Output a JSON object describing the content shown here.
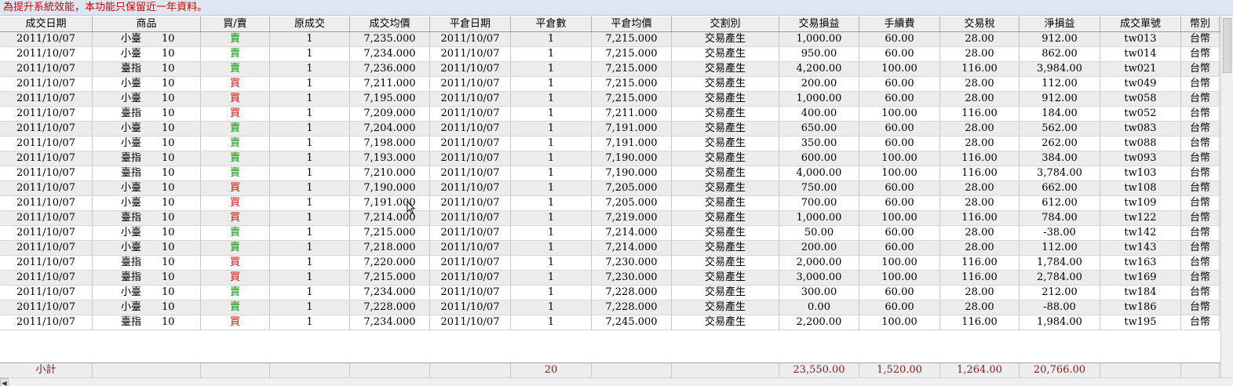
{
  "notice": "為提升系統效能，本功能只保留近一年資料。",
  "columns": [
    "成交日期",
    "商品",
    "買/賣",
    "原成交",
    "成交均價",
    "平倉日期",
    "平倉數",
    "平倉均價",
    "交割別",
    "交易損益",
    "手續費",
    "交易稅",
    "淨損益",
    "成交單號",
    "幣別"
  ],
  "colors": {
    "buy": "#e00000",
    "sell": "#00a000",
    "notice": "#d40000",
    "total": "#8b1a1a"
  },
  "rows": [
    {
      "date": "2011/10/07",
      "product": "小臺",
      "qty": "10",
      "side": "賣",
      "side_type": "sell",
      "orig": "1",
      "avg": "7,235.000",
      "close_date": "2011/10/07",
      "close_qty": "1",
      "close_avg": "7,215.000",
      "settle": "交易產生",
      "pnl": "1,000.00",
      "fee": "60.00",
      "tax": "28.00",
      "net": "912.00",
      "order": "tw013",
      "currency": "台幣"
    },
    {
      "date": "2011/10/07",
      "product": "小臺",
      "qty": "10",
      "side": "賣",
      "side_type": "sell",
      "orig": "1",
      "avg": "7,234.000",
      "close_date": "2011/10/07",
      "close_qty": "1",
      "close_avg": "7,215.000",
      "settle": "交易產生",
      "pnl": "950.00",
      "fee": "60.00",
      "tax": "28.00",
      "net": "862.00",
      "order": "tw014",
      "currency": "台幣"
    },
    {
      "date": "2011/10/07",
      "product": "臺指",
      "qty": "10",
      "side": "賣",
      "side_type": "sell",
      "orig": "1",
      "avg": "7,236.000",
      "close_date": "2011/10/07",
      "close_qty": "1",
      "close_avg": "7,215.000",
      "settle": "交易產生",
      "pnl": "4,200.00",
      "fee": "100.00",
      "tax": "116.00",
      "net": "3,984.00",
      "order": "tw021",
      "currency": "台幣"
    },
    {
      "date": "2011/10/07",
      "product": "小臺",
      "qty": "10",
      "side": "買",
      "side_type": "buy",
      "orig": "1",
      "avg": "7,211.000",
      "close_date": "2011/10/07",
      "close_qty": "1",
      "close_avg": "7,215.000",
      "settle": "交易產生",
      "pnl": "200.00",
      "fee": "60.00",
      "tax": "28.00",
      "net": "112.00",
      "order": "tw049",
      "currency": "台幣"
    },
    {
      "date": "2011/10/07",
      "product": "小臺",
      "qty": "10",
      "side": "買",
      "side_type": "buy",
      "orig": "1",
      "avg": "7,195.000",
      "close_date": "2011/10/07",
      "close_qty": "1",
      "close_avg": "7,215.000",
      "settle": "交易產生",
      "pnl": "1,000.00",
      "fee": "60.00",
      "tax": "28.00",
      "net": "912.00",
      "order": "tw058",
      "currency": "台幣"
    },
    {
      "date": "2011/10/07",
      "product": "臺指",
      "qty": "10",
      "side": "買",
      "side_type": "buy",
      "orig": "1",
      "avg": "7,209.000",
      "close_date": "2011/10/07",
      "close_qty": "1",
      "close_avg": "7,211.000",
      "settle": "交易產生",
      "pnl": "400.00",
      "fee": "100.00",
      "tax": "116.00",
      "net": "184.00",
      "order": "tw052",
      "currency": "台幣"
    },
    {
      "date": "2011/10/07",
      "product": "小臺",
      "qty": "10",
      "side": "賣",
      "side_type": "sell",
      "orig": "1",
      "avg": "7,204.000",
      "close_date": "2011/10/07",
      "close_qty": "1",
      "close_avg": "7,191.000",
      "settle": "交易產生",
      "pnl": "650.00",
      "fee": "60.00",
      "tax": "28.00",
      "net": "562.00",
      "order": "tw083",
      "currency": "台幣"
    },
    {
      "date": "2011/10/07",
      "product": "小臺",
      "qty": "10",
      "side": "賣",
      "side_type": "sell",
      "orig": "1",
      "avg": "7,198.000",
      "close_date": "2011/10/07",
      "close_qty": "1",
      "close_avg": "7,191.000",
      "settle": "交易產生",
      "pnl": "350.00",
      "fee": "60.00",
      "tax": "28.00",
      "net": "262.00",
      "order": "tw088",
      "currency": "台幣"
    },
    {
      "date": "2011/10/07",
      "product": "臺指",
      "qty": "10",
      "side": "賣",
      "side_type": "sell",
      "orig": "1",
      "avg": "7,193.000",
      "close_date": "2011/10/07",
      "close_qty": "1",
      "close_avg": "7,190.000",
      "settle": "交易產生",
      "pnl": "600.00",
      "fee": "100.00",
      "tax": "116.00",
      "net": "384.00",
      "order": "tw093",
      "currency": "台幣"
    },
    {
      "date": "2011/10/07",
      "product": "臺指",
      "qty": "10",
      "side": "賣",
      "side_type": "sell",
      "orig": "1",
      "avg": "7,210.000",
      "close_date": "2011/10/07",
      "close_qty": "1",
      "close_avg": "7,190.000",
      "settle": "交易產生",
      "pnl": "4,000.00",
      "fee": "100.00",
      "tax": "116.00",
      "net": "3,784.00",
      "order": "tw103",
      "currency": "台幣"
    },
    {
      "date": "2011/10/07",
      "product": "小臺",
      "qty": "10",
      "side": "買",
      "side_type": "buy",
      "orig": "1",
      "avg": "7,190.000",
      "close_date": "2011/10/07",
      "close_qty": "1",
      "close_avg": "7,205.000",
      "settle": "交易產生",
      "pnl": "750.00",
      "fee": "60.00",
      "tax": "28.00",
      "net": "662.00",
      "order": "tw108",
      "currency": "台幣"
    },
    {
      "date": "2011/10/07",
      "product": "小臺",
      "qty": "10",
      "side": "買",
      "side_type": "buy",
      "orig": "1",
      "avg": "7,191.000",
      "close_date": "2011/10/07",
      "close_qty": "1",
      "close_avg": "7,205.000",
      "settle": "交易產生",
      "pnl": "700.00",
      "fee": "60.00",
      "tax": "28.00",
      "net": "612.00",
      "order": "tw109",
      "currency": "台幣"
    },
    {
      "date": "2011/10/07",
      "product": "臺指",
      "qty": "10",
      "side": "買",
      "side_type": "buy",
      "orig": "1",
      "avg": "7,214.000",
      "close_date": "2011/10/07",
      "close_qty": "1",
      "close_avg": "7,219.000",
      "settle": "交易產生",
      "pnl": "1,000.00",
      "fee": "100.00",
      "tax": "116.00",
      "net": "784.00",
      "order": "tw122",
      "currency": "台幣"
    },
    {
      "date": "2011/10/07",
      "product": "小臺",
      "qty": "10",
      "side": "賣",
      "side_type": "sell",
      "orig": "1",
      "avg": "7,215.000",
      "close_date": "2011/10/07",
      "close_qty": "1",
      "close_avg": "7,214.000",
      "settle": "交易產生",
      "pnl": "50.00",
      "fee": "60.00",
      "tax": "28.00",
      "net": "-38.00",
      "order": "tw142",
      "currency": "台幣"
    },
    {
      "date": "2011/10/07",
      "product": "小臺",
      "qty": "10",
      "side": "賣",
      "side_type": "sell",
      "orig": "1",
      "avg": "7,218.000",
      "close_date": "2011/10/07",
      "close_qty": "1",
      "close_avg": "7,214.000",
      "settle": "交易產生",
      "pnl": "200.00",
      "fee": "60.00",
      "tax": "28.00",
      "net": "112.00",
      "order": "tw143",
      "currency": "台幣"
    },
    {
      "date": "2011/10/07",
      "product": "臺指",
      "qty": "10",
      "side": "買",
      "side_type": "buy",
      "orig": "1",
      "avg": "7,220.000",
      "close_date": "2011/10/07",
      "close_qty": "1",
      "close_avg": "7,230.000",
      "settle": "交易產生",
      "pnl": "2,000.00",
      "fee": "100.00",
      "tax": "116.00",
      "net": "1,784.00",
      "order": "tw163",
      "currency": "台幣"
    },
    {
      "date": "2011/10/07",
      "product": "臺指",
      "qty": "10",
      "side": "買",
      "side_type": "buy",
      "orig": "1",
      "avg": "7,215.000",
      "close_date": "2011/10/07",
      "close_qty": "1",
      "close_avg": "7,230.000",
      "settle": "交易產生",
      "pnl": "3,000.00",
      "fee": "100.00",
      "tax": "116.00",
      "net": "2,784.00",
      "order": "tw169",
      "currency": "台幣"
    },
    {
      "date": "2011/10/07",
      "product": "小臺",
      "qty": "10",
      "side": "賣",
      "side_type": "sell",
      "orig": "1",
      "avg": "7,234.000",
      "close_date": "2011/10/07",
      "close_qty": "1",
      "close_avg": "7,228.000",
      "settle": "交易產生",
      "pnl": "300.00",
      "fee": "60.00",
      "tax": "28.00",
      "net": "212.00",
      "order": "tw184",
      "currency": "台幣"
    },
    {
      "date": "2011/10/07",
      "product": "小臺",
      "qty": "10",
      "side": "賣",
      "side_type": "sell",
      "orig": "1",
      "avg": "7,228.000",
      "close_date": "2011/10/07",
      "close_qty": "1",
      "close_avg": "7,228.000",
      "settle": "交易產生",
      "pnl": "0.00",
      "fee": "60.00",
      "tax": "28.00",
      "net": "-88.00",
      "order": "tw186",
      "currency": "台幣"
    },
    {
      "date": "2011/10/07",
      "product": "臺指",
      "qty": "10",
      "side": "買",
      "side_type": "buy",
      "orig": "1",
      "avg": "7,234.000",
      "close_date": "2011/10/07",
      "close_qty": "1",
      "close_avg": "7,245.000",
      "settle": "交易產生",
      "pnl": "2,200.00",
      "fee": "100.00",
      "tax": "116.00",
      "net": "1,984.00",
      "order": "tw195",
      "currency": "台幣"
    }
  ],
  "totals": {
    "label": "小計",
    "close_qty": "20",
    "pnl": "23,550.00",
    "fee": "1,520.00",
    "tax": "1,264.00",
    "net": "20,766.00"
  },
  "icons": {
    "scroll_left": "arrow-left-icon",
    "cursor": "mouse-pointer-icon"
  }
}
